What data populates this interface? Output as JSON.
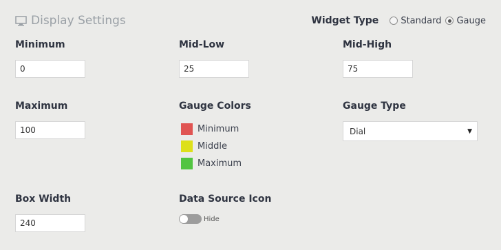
{
  "header": {
    "title": "Display Settings",
    "icon": "monitor-icon"
  },
  "widget_type": {
    "label": "Widget Type",
    "options": [
      {
        "label": "Standard",
        "selected": false
      },
      {
        "label": "Gauge",
        "selected": true
      }
    ]
  },
  "fields": {
    "minimum": {
      "label": "Minimum",
      "value": "0"
    },
    "mid_low": {
      "label": "Mid-Low",
      "value": "25"
    },
    "mid_high": {
      "label": "Mid-High",
      "value": "75"
    },
    "maximum": {
      "label": "Maximum",
      "value": "100"
    },
    "box_width": {
      "label": "Box Width",
      "value": "240"
    }
  },
  "gauge_colors": {
    "label": "Gauge Colors",
    "items": [
      {
        "label": "Minimum",
        "color": "#e05452"
      },
      {
        "label": "Middle",
        "color": "#dde01a"
      },
      {
        "label": "Maximum",
        "color": "#52c441"
      }
    ]
  },
  "gauge_type": {
    "label": "Gauge Type",
    "selected": "Dial"
  },
  "data_source_icon": {
    "label": "Data Source Icon",
    "toggle_label": "Hide",
    "enabled": false
  }
}
